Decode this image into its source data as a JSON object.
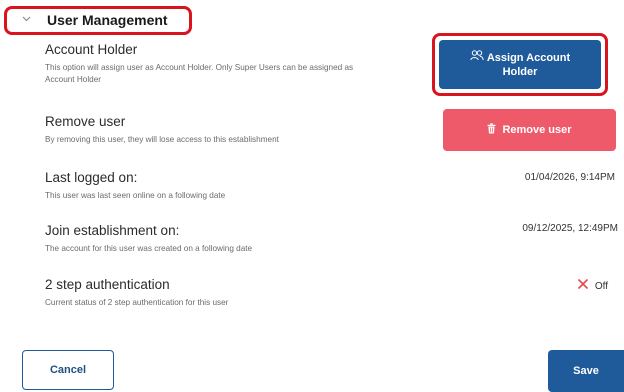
{
  "section": {
    "title": "User Management"
  },
  "account_holder": {
    "title": "Account Holder",
    "description": "This option will assign user as Account Holder. Only Super Users can be assigned as Account Holder",
    "button_line1": "Assign Account",
    "button_line2": "Holder"
  },
  "remove_user": {
    "title": "Remove user",
    "description": "By removing this user, they will lose access to this establishment",
    "button_label": "Remove user"
  },
  "last_logged": {
    "title": "Last logged on:",
    "description": "This user was last seen online on a following date",
    "value": "01/04/2026, 9:14PM"
  },
  "join_establishment": {
    "title": "Join establishment on:",
    "description": "The account for this user was created on a following date",
    "value": "09/12/2025, 12:49PM"
  },
  "two_step": {
    "title": "2 step authentication",
    "description": "Current status of 2 step authentication for this user",
    "status": "Off"
  },
  "footer": {
    "cancel_label": "Cancel",
    "save_label": "Save"
  },
  "colors": {
    "primary": "#1f5b9b",
    "danger": "#ef5a6b",
    "highlight": "#d8141e",
    "off_x": "#e5484d"
  },
  "icons": {
    "chevron": "chevron-down-icon",
    "assign": "users-icon",
    "remove": "trash-icon",
    "status_off": "close-icon"
  }
}
